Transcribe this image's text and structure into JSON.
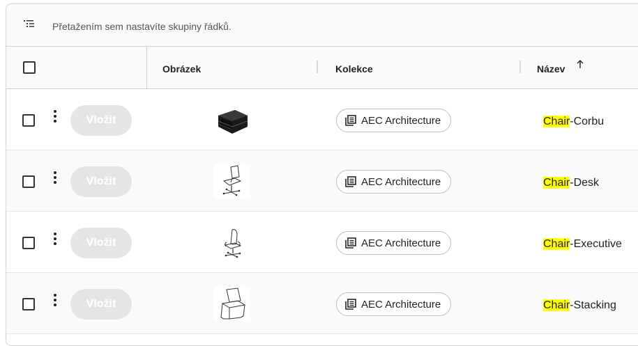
{
  "group_bar": {
    "icon": "group-rows-icon",
    "hint": "Přetažením sem nastavíte skupiny řádků."
  },
  "header": {
    "columns": [
      {
        "label": "Obrázek"
      },
      {
        "label": "Kolekce"
      },
      {
        "label": "Název",
        "sort": "ascending",
        "sort_icon": "arrow-up-icon"
      }
    ]
  },
  "rows": [
    {
      "insert_label": "Vložit",
      "image": "chair-corbu-thumbnail",
      "collection": "AEC Architecture",
      "name_highlight": "Chair",
      "name_rest": "-Corbu"
    },
    {
      "insert_label": "Vložit",
      "image": "chair-desk-thumbnail",
      "collection": "AEC Architecture",
      "name_highlight": "Chair",
      "name_rest": "-Desk"
    },
    {
      "insert_label": "Vložit",
      "image": "chair-executive-thumbnail",
      "collection": "AEC Architecture",
      "name_highlight": "Chair",
      "name_rest": "-Executive"
    },
    {
      "insert_label": "Vložit",
      "image": "chair-stacking-thumbnail",
      "collection": "AEC Architecture",
      "name_highlight": "Chair",
      "name_rest": "-Stacking"
    }
  ],
  "colors": {
    "highlight": "#ffff00",
    "disabled_button": "#e5e5e5",
    "border": "#d4d4d4"
  }
}
